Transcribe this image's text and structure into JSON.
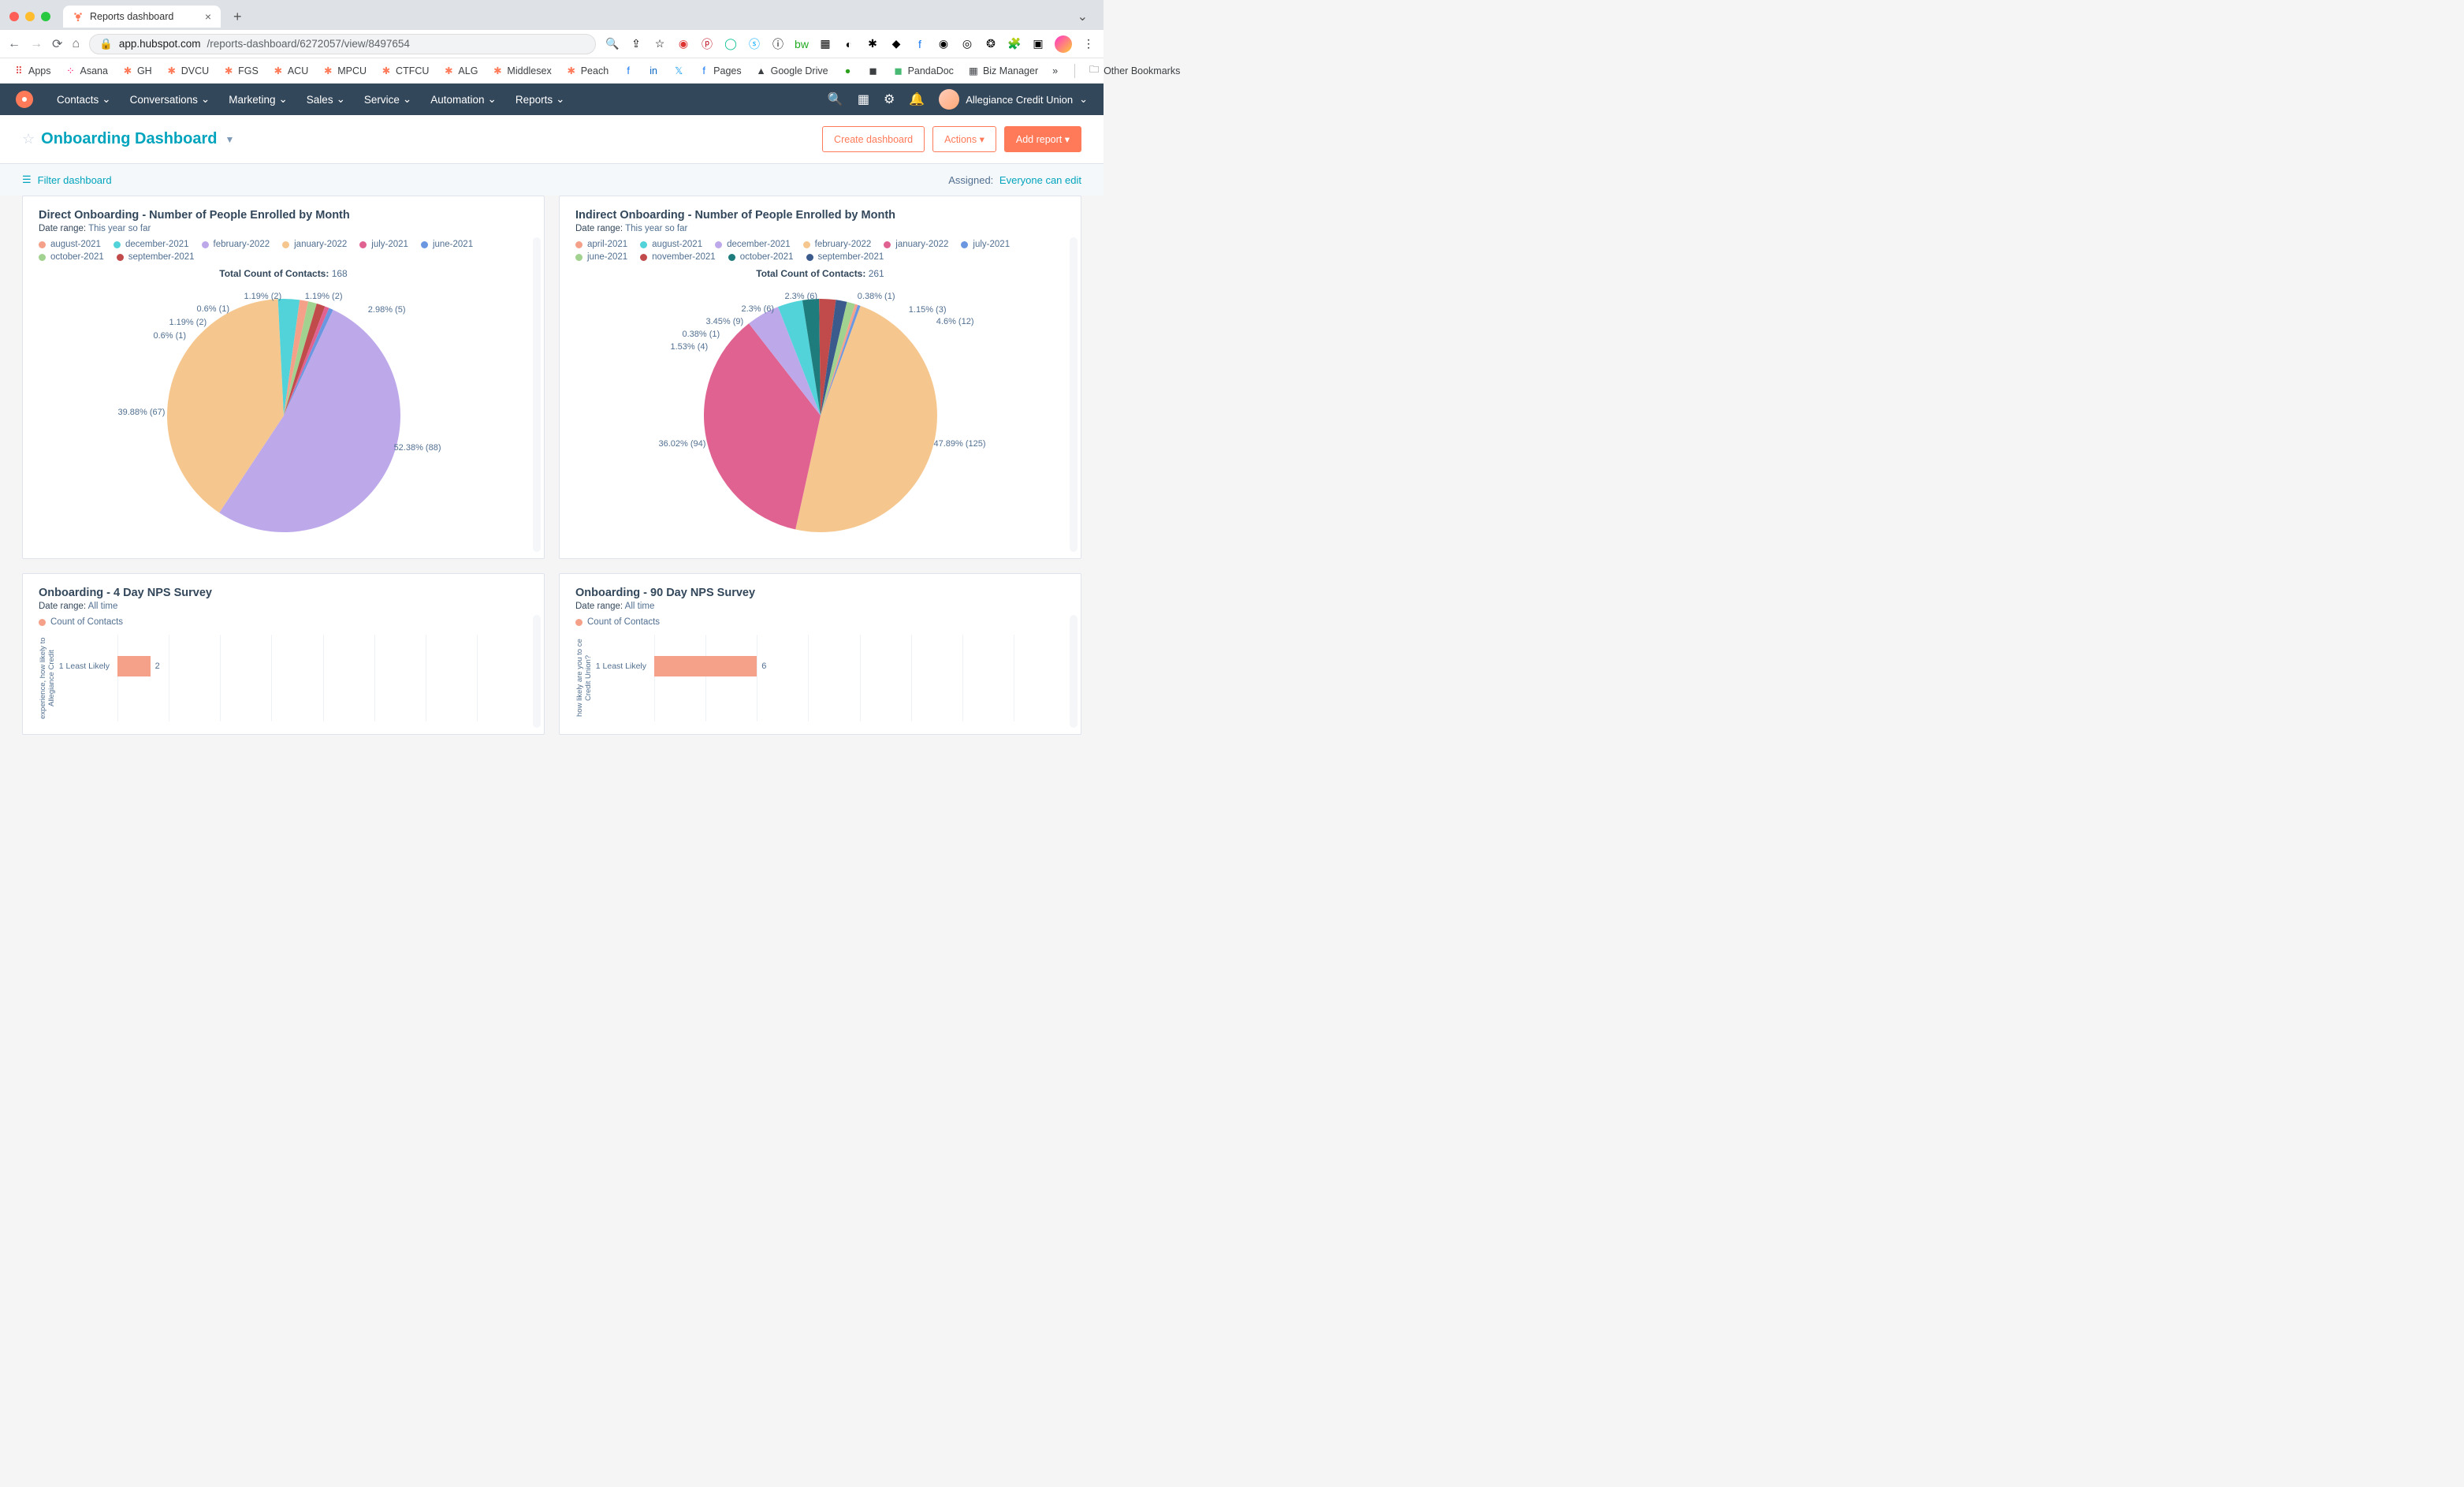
{
  "browser": {
    "tab_title": "Reports dashboard",
    "url_display_prefix": "app.hubspot.com",
    "url_display_path": "/reports-dashboard/6272057/view/8497654",
    "bookmarks": [
      "Apps",
      "Asana",
      "GH",
      "DVCU",
      "FGS",
      "ACU",
      "MPCU",
      "CTFCU",
      "ALG",
      "Middlesex",
      "Peach",
      "Pages",
      "Google Drive",
      "PandaDoc",
      "Biz Manager"
    ],
    "bookmarks_overflow": "»",
    "other_bookmarks": "Other Bookmarks"
  },
  "nav": {
    "items": [
      "Contacts",
      "Conversations",
      "Marketing",
      "Sales",
      "Service",
      "Automation",
      "Reports"
    ],
    "account": "Allegiance Credit Union"
  },
  "dashboard": {
    "title": "Onboarding Dashboard",
    "create_btn": "Create dashboard",
    "actions_btn": "Actions",
    "add_report_btn": "Add report",
    "filter_label": "Filter dashboard",
    "assigned_label": "Assigned:",
    "assigned_value": "Everyone can edit"
  },
  "reports": [
    {
      "title": "Direct Onboarding - Number of People Enrolled by Month",
      "date_range_label": "Date range:",
      "date_range_value": "This year so far",
      "legend": [
        {
          "label": "august-2021",
          "color": "#f5a18a"
        },
        {
          "label": "december-2021",
          "color": "#51d3d9"
        },
        {
          "label": "february-2022",
          "color": "#bda9ea"
        },
        {
          "label": "january-2022",
          "color": "#f5c78e"
        },
        {
          "label": "july-2021",
          "color": "#e06291"
        },
        {
          "label": "june-2021",
          "color": "#6a97e0"
        },
        {
          "label": "october-2021",
          "color": "#a2d28f"
        },
        {
          "label": "september-2021",
          "color": "#c14b4b"
        }
      ],
      "total_label": "Total Count of Contacts:",
      "total_value": "168",
      "slice_labels": [
        "0.6% (1)",
        "1.19% (2)",
        "0.6% (1)",
        "1.19% (2)",
        "1.19% (2)",
        "2.98% (5)",
        "39.88% (67)",
        "52.38% (88)"
      ]
    },
    {
      "title": "Indirect Onboarding - Number of People Enrolled by Month",
      "date_range_label": "Date range:",
      "date_range_value": "This year so far",
      "legend": [
        {
          "label": "april-2021",
          "color": "#f5a18a"
        },
        {
          "label": "august-2021",
          "color": "#51d3d9"
        },
        {
          "label": "december-2021",
          "color": "#bda9ea"
        },
        {
          "label": "february-2022",
          "color": "#f5c78e"
        },
        {
          "label": "january-2022",
          "color": "#e06291"
        },
        {
          "label": "july-2021",
          "color": "#6a97e0"
        },
        {
          "label": "june-2021",
          "color": "#a2d28f"
        },
        {
          "label": "november-2021",
          "color": "#c14b4b"
        },
        {
          "label": "october-2021",
          "color": "#1f7c7c"
        },
        {
          "label": "september-2021",
          "color": "#3a5b8c"
        }
      ],
      "total_label": "Total Count of Contacts:",
      "total_value": "261",
      "slice_labels": [
        "1.53% (4)",
        "0.38% (1)",
        "3.45% (9)",
        "2.3% (6)",
        "2.3% (6)",
        "0.38% (1)",
        "1.15% (3)",
        "4.6% (12)",
        "36.02% (94)",
        "47.89% (125)"
      ]
    },
    {
      "title": "Onboarding - 4 Day NPS Survey",
      "date_range_label": "Date range:",
      "date_range_value": "All time",
      "legend": [
        {
          "label": "Count of Contacts",
          "color": "#f5a18a"
        }
      ],
      "y_axis": "experience, how likely to Allegiance Credit",
      "bar_row_label": "1 Least Likely",
      "bar_value": "2"
    },
    {
      "title": "Onboarding - 90 Day NPS Survey",
      "date_range_label": "Date range:",
      "date_range_value": "All time",
      "legend": [
        {
          "label": "Count of Contacts",
          "color": "#f5a18a"
        }
      ],
      "y_axis": "how likely are you to ce Credit Union?",
      "bar_row_label": "1 Least Likely",
      "bar_value": "6"
    }
  ],
  "chart_data": [
    {
      "type": "pie",
      "title": "Direct Onboarding - Number of People Enrolled by Month",
      "total": 168,
      "series": [
        {
          "name": "february-2022",
          "value": 88,
          "pct": 52.38,
          "color": "#bda9ea"
        },
        {
          "name": "january-2022",
          "value": 67,
          "pct": 39.88,
          "color": "#f5c78e"
        },
        {
          "name": "december-2021",
          "value": 5,
          "pct": 2.98,
          "color": "#51d3d9"
        },
        {
          "name": "august-2021",
          "value": 2,
          "pct": 1.19,
          "color": "#f5a18a"
        },
        {
          "name": "october-2021",
          "value": 2,
          "pct": 1.19,
          "color": "#a2d28f"
        },
        {
          "name": "september-2021",
          "value": 2,
          "pct": 1.19,
          "color": "#c14b4b"
        },
        {
          "name": "july-2021",
          "value": 1,
          "pct": 0.6,
          "color": "#e06291"
        },
        {
          "name": "june-2021",
          "value": 1,
          "pct": 0.6,
          "color": "#6a97e0"
        }
      ]
    },
    {
      "type": "pie",
      "title": "Indirect Onboarding - Number of People Enrolled by Month",
      "total": 261,
      "series": [
        {
          "name": "february-2022",
          "value": 125,
          "pct": 47.89,
          "color": "#f5c78e"
        },
        {
          "name": "january-2022",
          "value": 94,
          "pct": 36.02,
          "color": "#e06291"
        },
        {
          "name": "december-2021",
          "value": 12,
          "pct": 4.6,
          "color": "#bda9ea"
        },
        {
          "name": "august-2021",
          "value": 9,
          "pct": 3.45,
          "color": "#51d3d9"
        },
        {
          "name": "october-2021",
          "value": 6,
          "pct": 2.3,
          "color": "#1f7c7c"
        },
        {
          "name": "november-2021",
          "value": 6,
          "pct": 2.3,
          "color": "#c14b4b"
        },
        {
          "name": "september-2021",
          "value": 4,
          "pct": 1.53,
          "color": "#3a5b8c"
        },
        {
          "name": "june-2021",
          "value": 3,
          "pct": 1.15,
          "color": "#a2d28f"
        },
        {
          "name": "april-2021",
          "value": 1,
          "pct": 0.38,
          "color": "#f5a18a"
        },
        {
          "name": "july-2021",
          "value": 1,
          "pct": 0.38,
          "color": "#6a97e0"
        }
      ]
    },
    {
      "type": "bar",
      "title": "Onboarding - 4 Day NPS Survey",
      "ylabel": "experience, how likely to Allegiance Credit",
      "categories": [
        "1 Least Likely"
      ],
      "values": [
        2
      ]
    },
    {
      "type": "bar",
      "title": "Onboarding - 90 Day NPS Survey",
      "ylabel": "how likely are you to ce Credit Union?",
      "categories": [
        "1 Least Likely"
      ],
      "values": [
        6
      ]
    }
  ]
}
